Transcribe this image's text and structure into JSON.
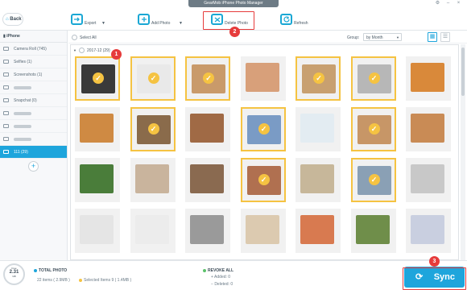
{
  "window": {
    "title": "GearMob iPhone Photo Manager"
  },
  "nav": {
    "back_label": "Back"
  },
  "toolbar": {
    "export_label": "Export",
    "add_photo_label": "Add Photo",
    "delete_photo_label": "Delete Photo",
    "refresh_label": "Refresh",
    "caret": "▼"
  },
  "sidebar": {
    "header": "iPhone",
    "items": [
      {
        "label": "Camera Roll (745)",
        "icon": "camera-roll-icon"
      },
      {
        "label": "Selfies (1)",
        "icon": "selfies-icon"
      },
      {
        "label": "Screenshots (1)",
        "icon": "screenshots-icon"
      },
      {
        "label": "",
        "icon": "album-icon"
      },
      {
        "label": "Snapchat (0)",
        "icon": "album-icon"
      },
      {
        "label": "",
        "icon": "album-icon"
      },
      {
        "label": "",
        "icon": "album-icon"
      },
      {
        "label": "",
        "icon": "album-icon"
      },
      {
        "label": "111 (29)",
        "icon": "user-album-icon",
        "active": true
      }
    ],
    "add_label": "+"
  },
  "content": {
    "select_all_label": "Select All",
    "group_label": "Group:",
    "group_value": "by Month",
    "section_label": "2017-12 (29)"
  },
  "annotations": {
    "badge1": "1",
    "badge2": "2",
    "badge3": "3"
  },
  "photos": [
    {
      "selected": true,
      "color": "#3a3a3a"
    },
    {
      "selected": true,
      "color": "#e9e9e9"
    },
    {
      "selected": true,
      "color": "#c99a6a"
    },
    {
      "selected": false,
      "color": "#d8a07a"
    },
    {
      "selected": true,
      "color": "#c8a070"
    },
    {
      "selected": true,
      "color": "#b7b7b7"
    },
    {
      "selected": false,
      "color": "#d9893a"
    },
    {
      "selected": false,
      "color": "#cf8a43"
    },
    {
      "selected": true,
      "color": "#8a6b4b"
    },
    {
      "selected": false,
      "color": "#a06a45"
    },
    {
      "selected": true,
      "color": "#7a9bc5"
    },
    {
      "selected": false,
      "color": "#e3ecf2"
    },
    {
      "selected": true,
      "color": "#c79667"
    },
    {
      "selected": false,
      "color": "#c98b55"
    },
    {
      "selected": false,
      "color": "#4a7d3a"
    },
    {
      "selected": false,
      "color": "#c9b49d"
    },
    {
      "selected": false,
      "color": "#8a6a50"
    },
    {
      "selected": true,
      "color": "#b07050"
    },
    {
      "selected": false,
      "color": "#c7b79a"
    },
    {
      "selected": true,
      "color": "#8aa0b5"
    },
    {
      "selected": false,
      "color": "#c8c8c8"
    },
    {
      "selected": false,
      "color": "#e5e5e5"
    },
    {
      "selected": false,
      "color": "#ececec"
    },
    {
      "selected": false,
      "color": "#9a9a9a"
    },
    {
      "selected": false,
      "color": "#dccab0"
    },
    {
      "selected": false,
      "color": "#d87a50"
    },
    {
      "selected": false,
      "color": "#6f8e4a"
    },
    {
      "selected": false,
      "color": "#c9cfe0"
    }
  ],
  "status": {
    "total_label": "TOTAL PHOTO",
    "total_value": "22 items ( 2.9MB )",
    "selected_value": "Selected Items 9 ( 1.4MB )",
    "revoke_label": "REVOKE ALL",
    "added_label": "Added: 0",
    "deleted_label": "Deleted: 0",
    "storage_free_label": "Free",
    "storage_value": "2.31",
    "storage_unit": "GB"
  },
  "sync": {
    "label": "Sync"
  },
  "colors": {
    "accent": "#1ea5dc",
    "select": "#f5c342",
    "annotation": "#e63b3b"
  }
}
